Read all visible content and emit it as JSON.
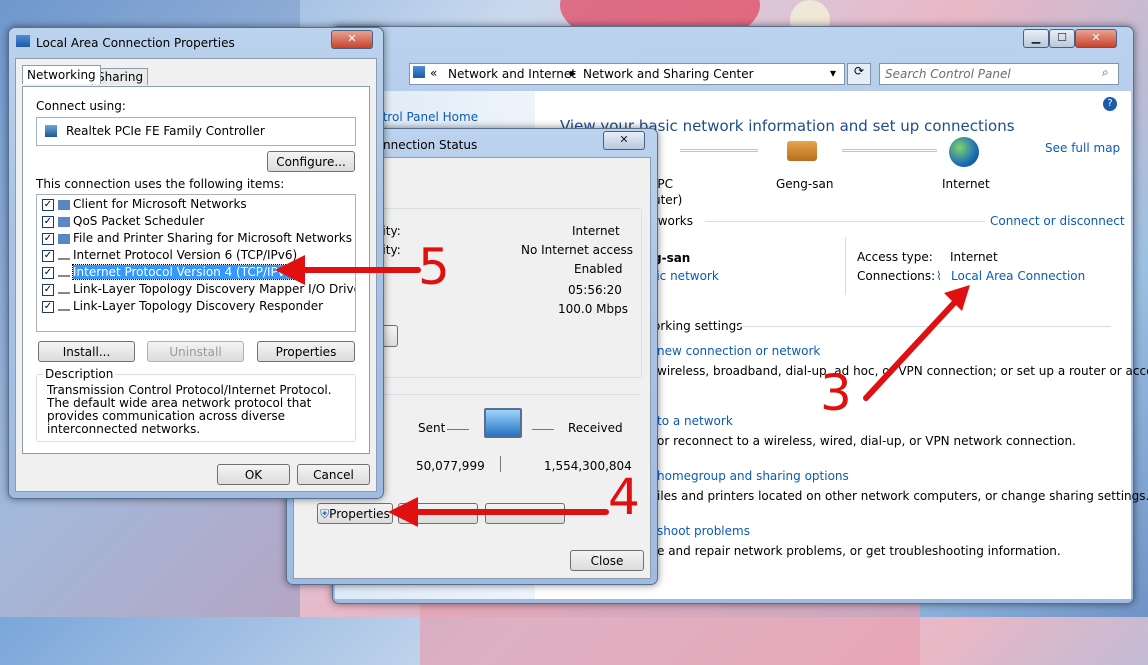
{
  "explorer": {
    "breadcrumb_sep_start": "«",
    "crumb1": "Network and Internet",
    "crumb_sep": "▸",
    "crumb2": "Network and Sharing Center",
    "search_placeholder": "Search Control Panel",
    "heading": "View your basic network information and set up connections",
    "see_full_map": "See full map",
    "map_pc": "-PC",
    "map_pc_sub": "uter)",
    "map_gateway": "Geng-san",
    "map_internet": "Internet",
    "networks_label": "tworks",
    "connect_or_disconnect": "Connect or disconnect",
    "network_name": "g-san",
    "network_type": "lic network",
    "access_type_label": "Access type:",
    "access_type_value": "Internet",
    "connections_label": "Connections:",
    "connections_value": "Local Area Connection",
    "sidebar_home": "ntrol Panel Home",
    "change_settings": "orking settings",
    "tasks": [
      {
        "link": "new connection or network",
        "desc": "wireless, broadband, dial-up, ad hoc, or VPN connection; or set up a router or access"
      },
      {
        "link": "to a network",
        "desc": "or reconnect to a wireless, wired, dial-up, or VPN network connection."
      },
      {
        "link": "homegroup and sharing options",
        "desc": "iles and printers located on other network computers, or change sharing settings."
      },
      {
        "link": "shoot problems",
        "desc": "e and repair network problems, or get troubleshooting information."
      }
    ]
  },
  "status": {
    "title": "nnection Status",
    "rows": [
      {
        "label": "ivity:",
        "value": "Internet"
      },
      {
        "label": "ivity:",
        "value": "No Internet access"
      },
      {
        "label": "",
        "value": "Enabled"
      },
      {
        "label": "",
        "value": "05:56:20"
      },
      {
        "label": "",
        "value": "100.0 Mbps"
      }
    ],
    "sent_label": "Sent",
    "received_label": "Received",
    "sent_value": "50,077,999",
    "received_value": "1,554,300,804",
    "properties_label": "Properties",
    "close_label": "Close"
  },
  "props": {
    "title": "Local Area Connection Properties",
    "tab_networking": "Networking",
    "tab_sharing": "Sharing",
    "connect_using_label": "Connect using:",
    "adapter": "Realtek PCIe FE Family Controller",
    "configure": "Configure...",
    "items_label": "This connection uses the following items:",
    "items": [
      "Client for Microsoft Networks",
      "QoS Packet Scheduler",
      "File and Printer Sharing for Microsoft Networks",
      "Internet Protocol Version 6 (TCP/IPv6)",
      "Internet Protocol Version 4 (TCP/IPv4)",
      "Link-Layer Topology Discovery Mapper I/O Driver",
      "Link-Layer Topology Discovery Responder"
    ],
    "install": "Install...",
    "uninstall": "Uninstall",
    "properties": "Properties",
    "description_label": "Description",
    "description": "Transmission Control Protocol/Internet Protocol. The default wide area network protocol that provides communication across diverse interconnected networks.",
    "ok": "OK",
    "cancel": "Cancel"
  },
  "annotations": {
    "n3": "3",
    "n4": "4",
    "n5": "5",
    "color": "#e01010"
  }
}
